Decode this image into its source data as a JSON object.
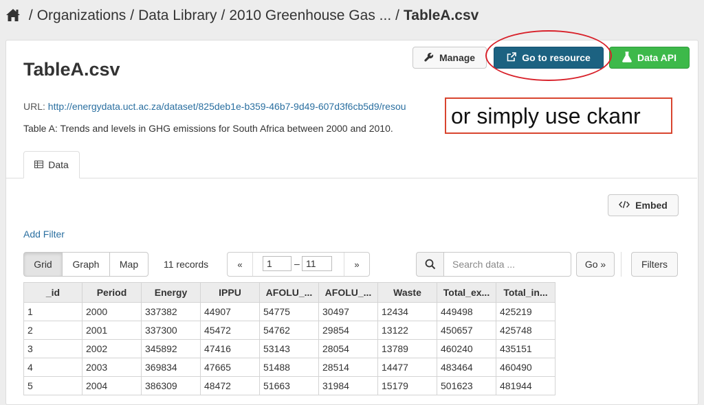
{
  "breadcrumb": {
    "items": [
      "Organizations",
      "Data Library",
      "2010 Greenhouse Gas ..."
    ],
    "current": "TableA.csv",
    "separator": "/"
  },
  "resource": {
    "title": "TableA.csv",
    "url_label": "URL:",
    "url": "http://energydata.uct.ac.za/dataset/825deb1e-b359-46b7-9d49-607d3f6cb5d9/resou",
    "description": "Table A: Trends and levels in GHG emissions for South Africa between 2000 and 2010."
  },
  "actions": {
    "manage_label": "Manage",
    "goto_label": "Go to resource",
    "api_label": "Data API"
  },
  "annotation": {
    "text": "or simply use ",
    "bold": "ckanr",
    "color": "#d8212a"
  },
  "tabs": [
    {
      "label": "Data",
      "active": true
    }
  ],
  "toolbar": {
    "embed_label": "Embed",
    "add_filter_label": "Add Filter",
    "views": [
      "Grid",
      "Graph",
      "Map"
    ],
    "records_label": "11 records",
    "pager": {
      "prev": "«",
      "from": "1",
      "to": "11",
      "dash": "–",
      "next": "»"
    },
    "search_placeholder": "Search data ...",
    "go_label": "Go »",
    "filters_label": "Filters"
  },
  "table": {
    "columns": [
      "_id",
      "Period",
      "Energy",
      "IPPU",
      "AFOLU_...",
      "AFOLU_...",
      "Waste",
      "Total_ex...",
      "Total_in..."
    ],
    "rows": [
      [
        "1",
        "2000",
        "337382",
        "44907",
        "54775",
        "30497",
        "12434",
        "449498",
        "425219"
      ],
      [
        "2",
        "2001",
        "337300",
        "45472",
        "54762",
        "29854",
        "13122",
        "450657",
        "425748"
      ],
      [
        "3",
        "2002",
        "345892",
        "47416",
        "53143",
        "28054",
        "13789",
        "460240",
        "435151"
      ],
      [
        "4",
        "2003",
        "369834",
        "47665",
        "51488",
        "28514",
        "14477",
        "483464",
        "460490"
      ],
      [
        "5",
        "2004",
        "386309",
        "48472",
        "51663",
        "31984",
        "15179",
        "501623",
        "481944"
      ]
    ]
  },
  "colors": {
    "goto_button": "#1c6281",
    "api_button": "#3db94a",
    "link": "#2a6fa0"
  }
}
